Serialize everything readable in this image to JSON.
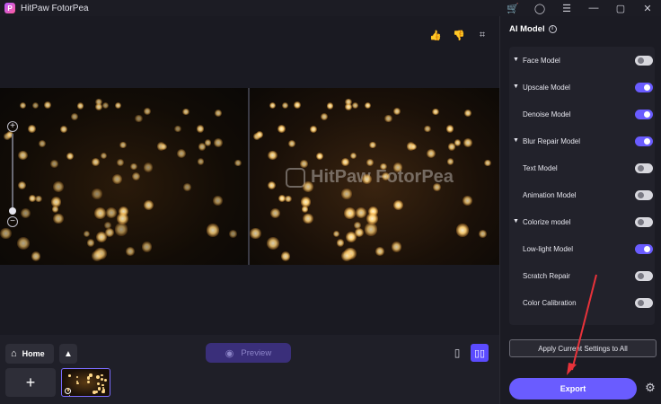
{
  "app": {
    "title": "HitPaw FotorPea",
    "logo_letter": "P"
  },
  "titlebar": {
    "cart_icon": "cart-icon",
    "account_icon": "user-icon",
    "menu_icon": "menu-icon"
  },
  "canvas": {
    "watermark": "HitPaw FotorPea"
  },
  "bottombar": {
    "home_label": "Home",
    "preview_label": "Preview"
  },
  "panel": {
    "title": "AI Model",
    "models": [
      {
        "name": "Face Model",
        "collapsible": true,
        "enabled": false
      },
      {
        "name": "Upscale Model",
        "collapsible": true,
        "enabled": true
      },
      {
        "name": "Denoise Model",
        "collapsible": false,
        "enabled": true
      },
      {
        "name": "Blur Repair Model",
        "collapsible": true,
        "enabled": true
      },
      {
        "name": "Text Model",
        "collapsible": false,
        "enabled": false
      },
      {
        "name": "Animation Model",
        "collapsible": false,
        "enabled": false
      },
      {
        "name": "Colorize model",
        "collapsible": true,
        "enabled": false
      },
      {
        "name": "Low-light Model",
        "collapsible": false,
        "enabled": true
      },
      {
        "name": "Scratch Repair",
        "collapsible": false,
        "enabled": false
      },
      {
        "name": "Color Calibration",
        "collapsible": false,
        "enabled": false
      }
    ],
    "apply_label": "Apply Current Settings to All",
    "export_label": "Export"
  },
  "colors": {
    "accent": "#6a5cff",
    "preview_bg": "#3a2f7a",
    "annotation_arrow": "#e8323a"
  }
}
